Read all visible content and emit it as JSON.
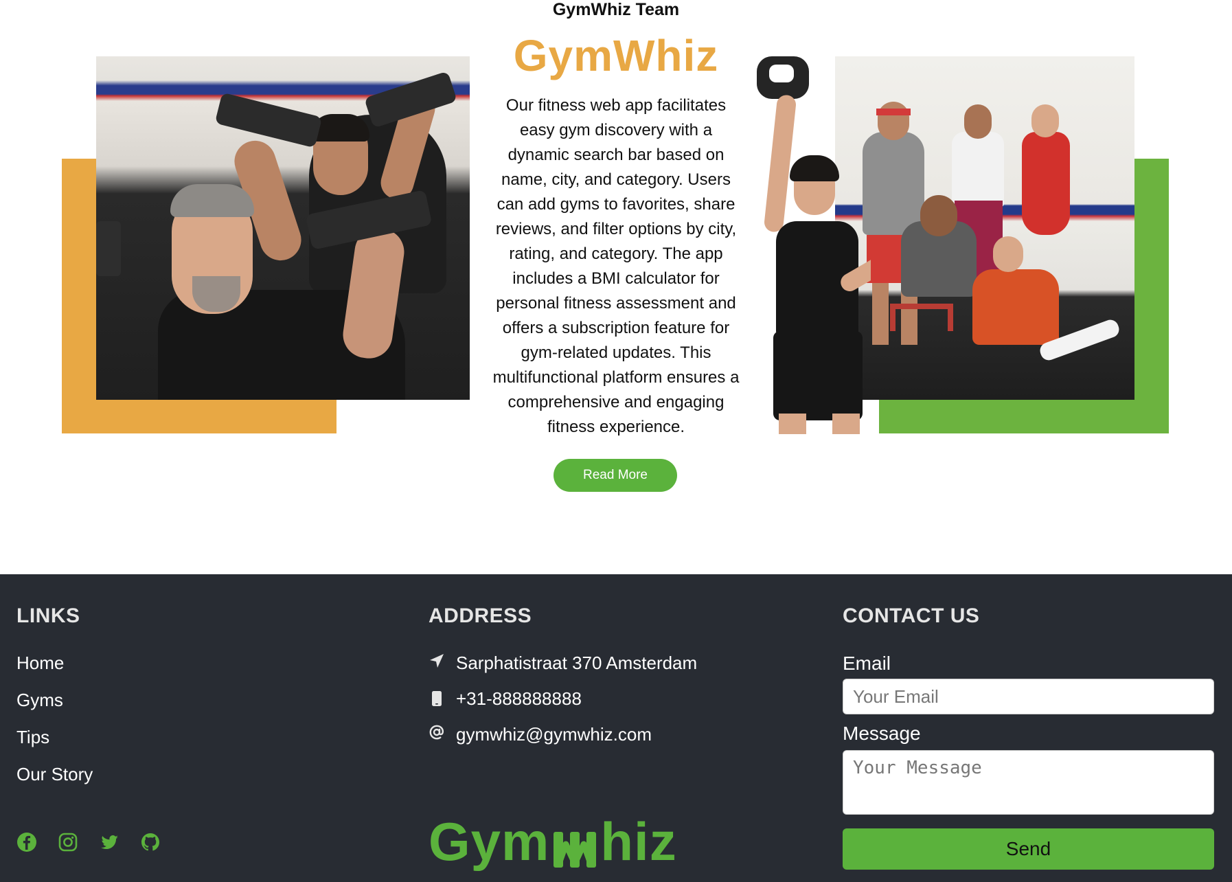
{
  "hero": {
    "team_title": "GymWhiz Team",
    "brand_heading": "GymWhiz",
    "description": "Our fitness web app facilitates easy gym discovery with a dynamic search bar based on name, city, and category. Users can add gyms to favorites, share reviews, and filter options by city, rating, and category. The app includes a BMI calculator for personal fitness assessment and offers a subscription feature for gym-related updates. This multifunctional platform ensures a comprehensive and engaging fitness experience.",
    "read_more_label": "Read More"
  },
  "colors": {
    "accent_orange": "#e8a844",
    "accent_green": "#5bb23c",
    "footer_bg": "#282c33"
  },
  "footer": {
    "links": {
      "title": "LINKS",
      "items": [
        {
          "label": "Home"
        },
        {
          "label": "Gyms"
        },
        {
          "label": "Tips"
        },
        {
          "label": "Our Story"
        }
      ],
      "social_icons": [
        "facebook-icon",
        "instagram-icon",
        "twitter-icon",
        "github-icon"
      ]
    },
    "address": {
      "title": "ADDRESS",
      "street": "Sarphatistraat 370 Amsterdam",
      "phone": "+31-888888888",
      "email": "gymwhiz@gymwhiz.com",
      "icons": [
        "location-arrow-icon",
        "mobile-phone-icon",
        "at-sign-icon"
      ],
      "logo_text_left": "Gym",
      "logo_text_right": "hiz"
    },
    "contact": {
      "title": "CONTACT US",
      "email_label": "Email",
      "email_placeholder": "Your Email",
      "message_label": "Message",
      "message_placeholder": "Your Message",
      "send_label": "Send"
    }
  }
}
